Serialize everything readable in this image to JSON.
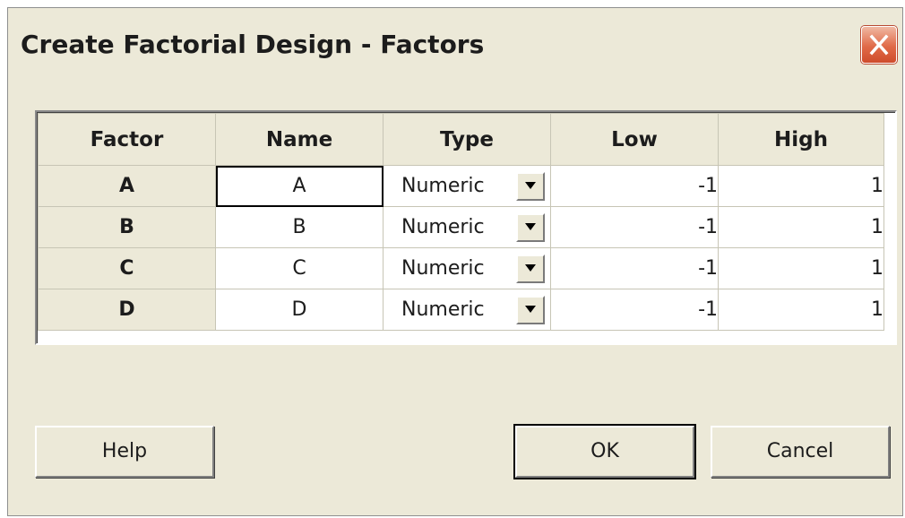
{
  "window": {
    "title": "Create Factorial Design - Factors"
  },
  "table": {
    "headers": [
      "Factor",
      "Name",
      "Type",
      "Low",
      "High"
    ],
    "rows": [
      {
        "factor": "A",
        "name": "A",
        "type": "Numeric",
        "low": "-1",
        "high": "1"
      },
      {
        "factor": "B",
        "name": "B",
        "type": "Numeric",
        "low": "-1",
        "high": "1"
      },
      {
        "factor": "C",
        "name": "C",
        "type": "Numeric",
        "low": "-1",
        "high": "1"
      },
      {
        "factor": "D",
        "name": "D",
        "type": "Numeric",
        "low": "-1",
        "high": "1"
      }
    ]
  },
  "buttons": {
    "help": "Help",
    "ok": "OK",
    "cancel": "Cancel"
  },
  "icons": {
    "close": "close-icon",
    "dropdown": "chevron-down-icon"
  },
  "colors": {
    "dialog_bg": "#ece9d8",
    "close_button": "#e06a48"
  }
}
